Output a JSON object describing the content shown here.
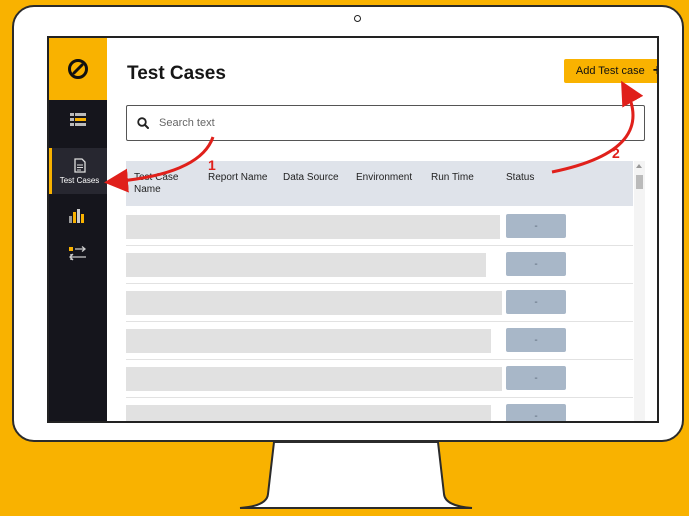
{
  "app": {
    "nav": [
      {
        "label": "",
        "icon": "list-icon"
      },
      {
        "label": "Test Cases",
        "icon": "document-icon"
      },
      {
        "label": "",
        "icon": "chart-bars-icon"
      },
      {
        "label": "",
        "icon": "transfer-icon"
      }
    ]
  },
  "header": {
    "title": "Test Cases",
    "add_button_label": "Add Test case",
    "add_button_symbol": "+"
  },
  "search": {
    "placeholder": "Search text"
  },
  "table": {
    "columns": [
      "Test Case Name",
      "Report Name",
      "Data Source",
      "Environment",
      "Run Time",
      "Status"
    ],
    "rows": [
      {
        "status": "-"
      },
      {
        "status": "-"
      },
      {
        "status": "-"
      },
      {
        "status": "-"
      },
      {
        "status": "-"
      },
      {
        "status": "-"
      }
    ]
  },
  "annotations": [
    "1",
    "2"
  ],
  "colors": {
    "accent": "#F9B200",
    "sidebar": "#15151c",
    "annotation_red": "#e0201b",
    "status_button": "#a8b7c8",
    "table_header": "#dfe3ea"
  }
}
